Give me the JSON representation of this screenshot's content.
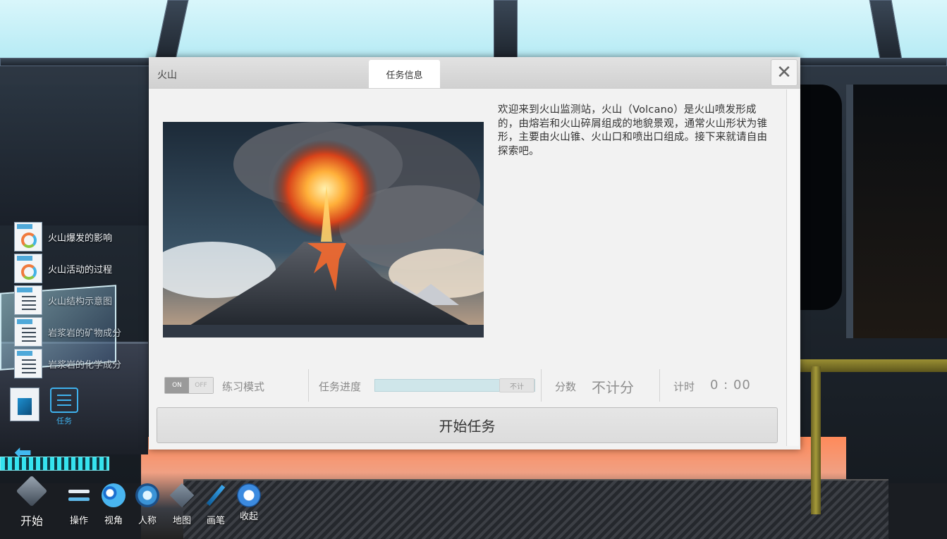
{
  "dialog": {
    "title": "火山",
    "tab_label": "任务信息",
    "close_symbol": "✕",
    "description": "欢迎来到火山监测站，火山（Volcano）是火山喷发形成的，由熔岩和火山碎屑组成的地貌景观，通常火山形状为锥形，主要由火山锥、火山口和喷出口组成。接下来就请自由探索吧。",
    "image_subject": "volcano-eruption",
    "practice_toggle": {
      "on_label": "ON",
      "off_label": "OFF",
      "state": "on"
    },
    "practice_label": "练习模式",
    "progress_label": "任务进度",
    "progress_tag": "不计",
    "progress_value": 0,
    "score_label": "分数",
    "score_value": "不计分",
    "timer_label": "计时",
    "timer_value": "0 : 00",
    "start_button": "开始任务"
  },
  "side_items": [
    {
      "label": "火山爆发的影响",
      "icon": "resource-rings-icon"
    },
    {
      "label": "火山活动的过程",
      "icon": "resource-rings-icon"
    },
    {
      "label": "火山结构示意图",
      "icon": "document-icon"
    },
    {
      "label": "岩浆岩的矿物成分",
      "icon": "document-icon"
    },
    {
      "label": "岩浆岩的化学成分",
      "icon": "document-icon"
    }
  ],
  "task_button": {
    "label": "任务",
    "icon": "clipboard-icon"
  },
  "toolbar": {
    "items": [
      {
        "label": "开始",
        "icon": "cube-icon"
      },
      {
        "label": "操作",
        "icon": "operate-icon"
      },
      {
        "label": "视角",
        "icon": "view-icon"
      },
      {
        "label": "人称",
        "icon": "person-icon"
      },
      {
        "label": "地图",
        "icon": "map-icon"
      },
      {
        "label": "画笔",
        "icon": "brush-icon"
      },
      {
        "label": "收起",
        "icon": "collapse-icon"
      }
    ]
  },
  "colors": {
    "accent_blue": "#3fb2ee",
    "progress_track": "#cfe6ea",
    "dialog_bg": "#f2f2f2"
  }
}
